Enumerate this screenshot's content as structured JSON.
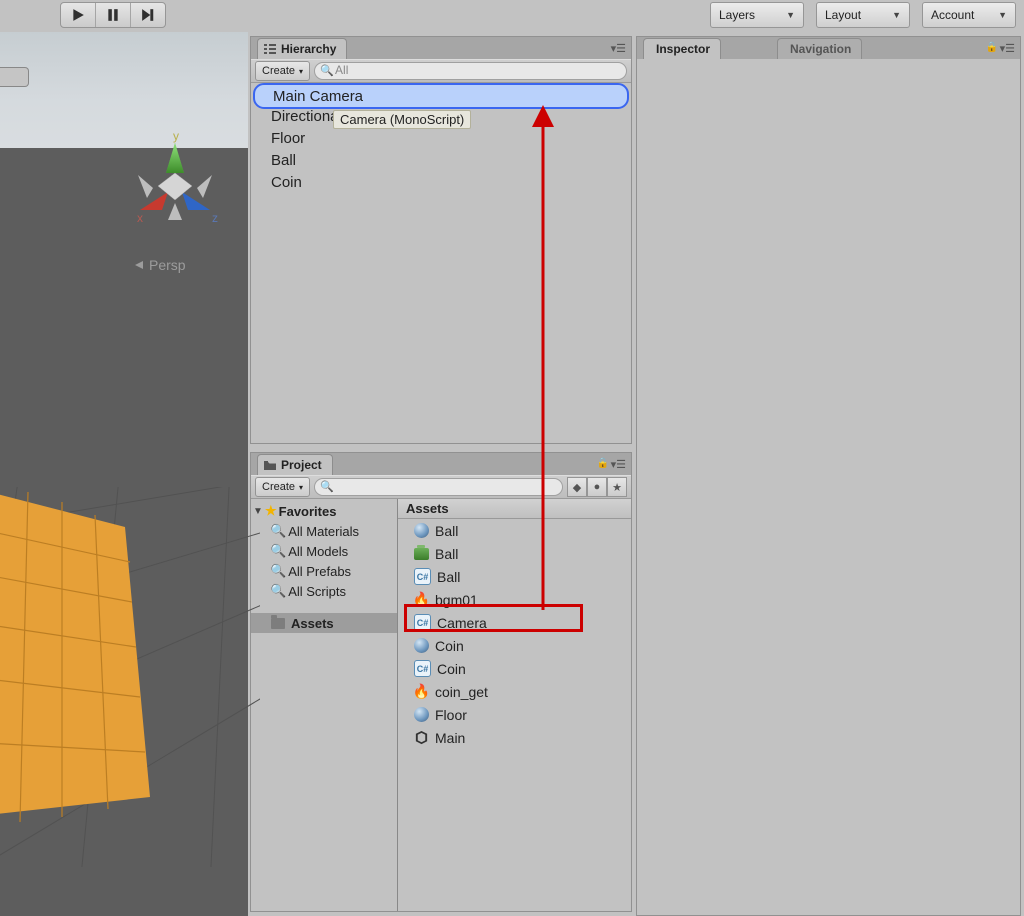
{
  "toolbar": {
    "dropdowns": [
      {
        "label": "Layers"
      },
      {
        "label": "Layout"
      },
      {
        "label": "Account"
      }
    ]
  },
  "scene": {
    "persp_label": "Persp",
    "axis": {
      "x": "x",
      "y": "y",
      "z": "z"
    }
  },
  "hierarchy": {
    "tab": "Hierarchy",
    "create": "Create",
    "search_placeholder": "All",
    "tooltip": "Camera (MonoScript)",
    "items": [
      {
        "name": "Main Camera",
        "selected": true
      },
      {
        "name": "Directional Light"
      },
      {
        "name": "Floor"
      },
      {
        "name": "Ball"
      },
      {
        "name": "Coin"
      }
    ]
  },
  "project": {
    "tab": "Project",
    "create": "Create",
    "favorites_label": "Favorites",
    "favorites": [
      "All Materials",
      "All Models",
      "All Prefabs",
      "All Scripts"
    ],
    "assets_folder": "Assets",
    "assets_header": "Assets",
    "assets": [
      {
        "icon": "sphere",
        "name": "Ball"
      },
      {
        "icon": "prefab",
        "name": "Ball"
      },
      {
        "icon": "cs",
        "name": "Ball"
      },
      {
        "icon": "fire",
        "name": "bgm01"
      },
      {
        "icon": "cs",
        "name": "Camera",
        "highlight": true
      },
      {
        "icon": "sphere",
        "name": "Coin"
      },
      {
        "icon": "cs",
        "name": "Coin"
      },
      {
        "icon": "fire",
        "name": "coin_get"
      },
      {
        "icon": "sphere",
        "name": "Floor"
      },
      {
        "icon": "unity",
        "name": "Main"
      }
    ]
  },
  "inspector": {
    "tab_inspector": "Inspector",
    "tab_navigation": "Navigation"
  }
}
